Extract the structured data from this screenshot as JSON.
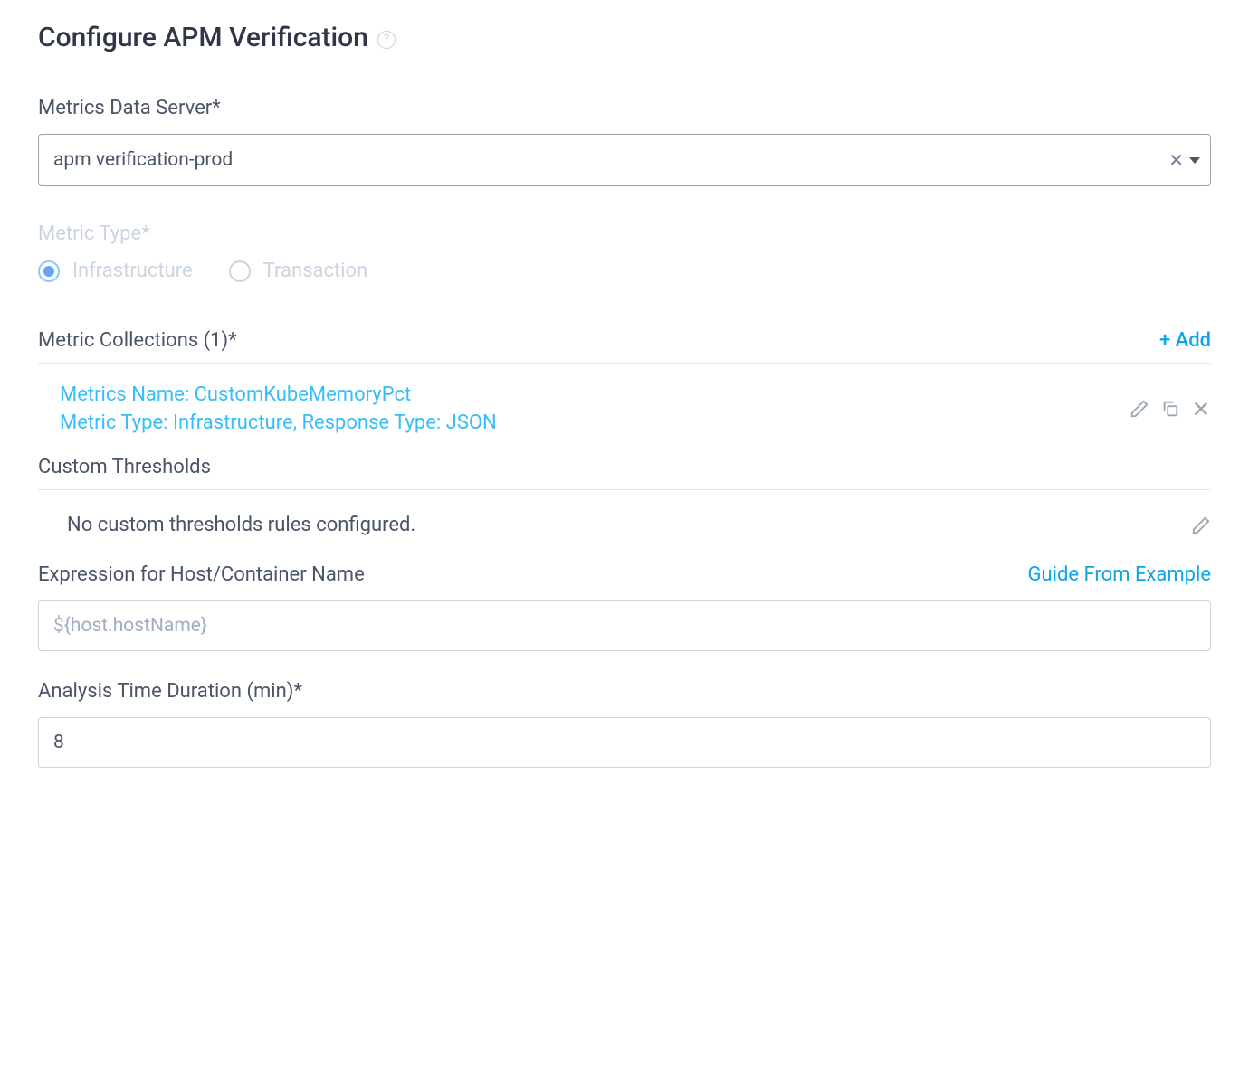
{
  "header": {
    "title": "Configure APM Verification"
  },
  "metricsDataServer": {
    "label": "Metrics Data Server*",
    "value": "apm verification-prod"
  },
  "metricType": {
    "label": "Metric Type*",
    "options": {
      "infrastructure": "Infrastructure",
      "transaction": "Transaction"
    },
    "selected": "infrastructure"
  },
  "metricCollections": {
    "label": "Metric Collections (1)*",
    "addLabel": "+ Add",
    "item": {
      "line1": "Metrics Name: CustomKubeMemoryPct",
      "line2": "Metric Type: Infrastructure, Response Type: JSON"
    }
  },
  "customThresholds": {
    "label": "Custom Thresholds",
    "emptyText": "No custom thresholds rules configured."
  },
  "expression": {
    "label": "Expression for Host/Container Name",
    "guideLabel": "Guide From Example",
    "placeholder": "${host.hostName}",
    "value": ""
  },
  "analysisDuration": {
    "label": "Analysis Time Duration (min)*",
    "value": "8"
  }
}
